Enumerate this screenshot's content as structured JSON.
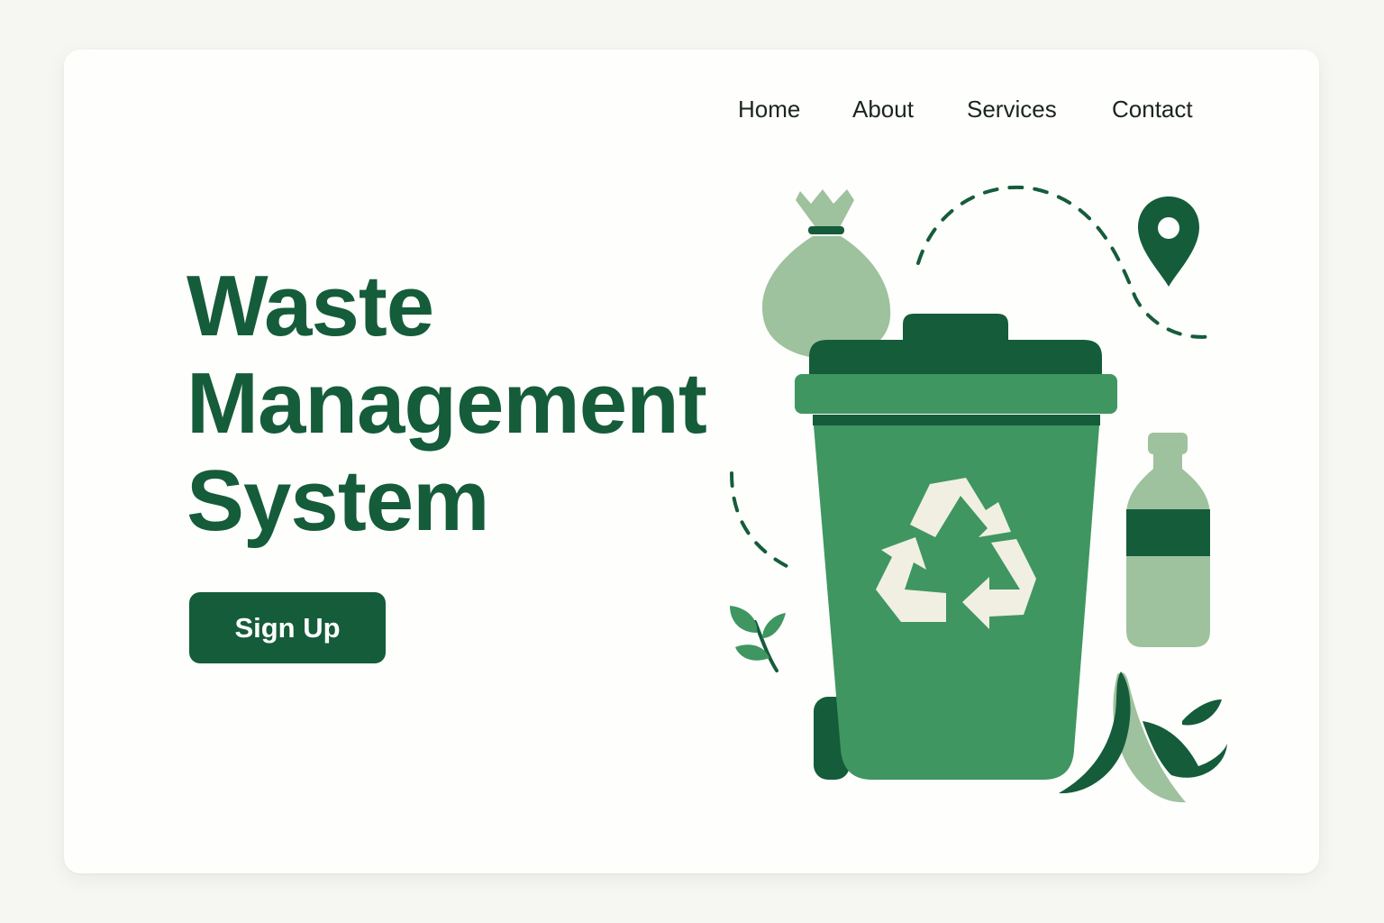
{
  "nav": {
    "items": [
      {
        "label": "Home"
      },
      {
        "label": "About"
      },
      {
        "label": "Services"
      },
      {
        "label": "Contact"
      }
    ]
  },
  "hero": {
    "title_lines": [
      "Waste",
      "Management",
      "System"
    ],
    "cta_label": "Sign Up"
  },
  "illustration": {
    "icons": [
      "trash-bag-icon",
      "recycle-bin-icon",
      "recycle-symbol-icon",
      "location-pin-icon",
      "plastic-bottle-icon",
      "banana-peel-icon",
      "leaf-sprout-icon"
    ]
  },
  "colors": {
    "background": "#f6f6f2",
    "card": "#fefefc",
    "brand_dark": "#155c3a",
    "brand_mid": "#3f9660",
    "brand_light": "#9ec19e",
    "text": "#1b2420",
    "button_text": "#ffffff"
  }
}
